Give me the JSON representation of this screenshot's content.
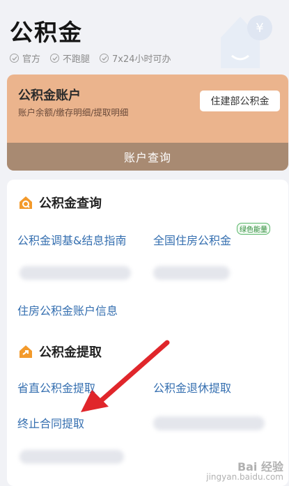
{
  "header": {
    "title": "公积金",
    "features": [
      "官方",
      "不跑腿",
      "7x24小时可办"
    ],
    "deco_icon": "yen-house-icon"
  },
  "account": {
    "title": "公积金账户",
    "subtitle": "账户余额/缴存明细/提取明细",
    "button_label": "住建部公积金",
    "query_label": "账户查询"
  },
  "query_section": {
    "title": "公积金查询",
    "icon": "house-search-icon",
    "items": [
      {
        "label": "公积金调基&结息指南"
      },
      {
        "label": "全国住房公积金",
        "badge": "绿色能量"
      },
      {
        "label": "住房公积金账户信息"
      }
    ]
  },
  "withdraw_section": {
    "title": "公积金提取",
    "icon": "house-arrow-icon",
    "items": [
      {
        "label": "省直公积金提取"
      },
      {
        "label": "公积金退休提取"
      },
      {
        "label": "终止合同提取"
      }
    ]
  },
  "watermark": {
    "line1": "Bai 经验",
    "line2": "jingyan.baidu.com"
  },
  "colors": {
    "accent": "#356fb0",
    "account_bg": "#ebb48d",
    "account_bar": "#a88a72",
    "icon_orange": "#f39a2b",
    "arrow_red": "#e0262b"
  }
}
